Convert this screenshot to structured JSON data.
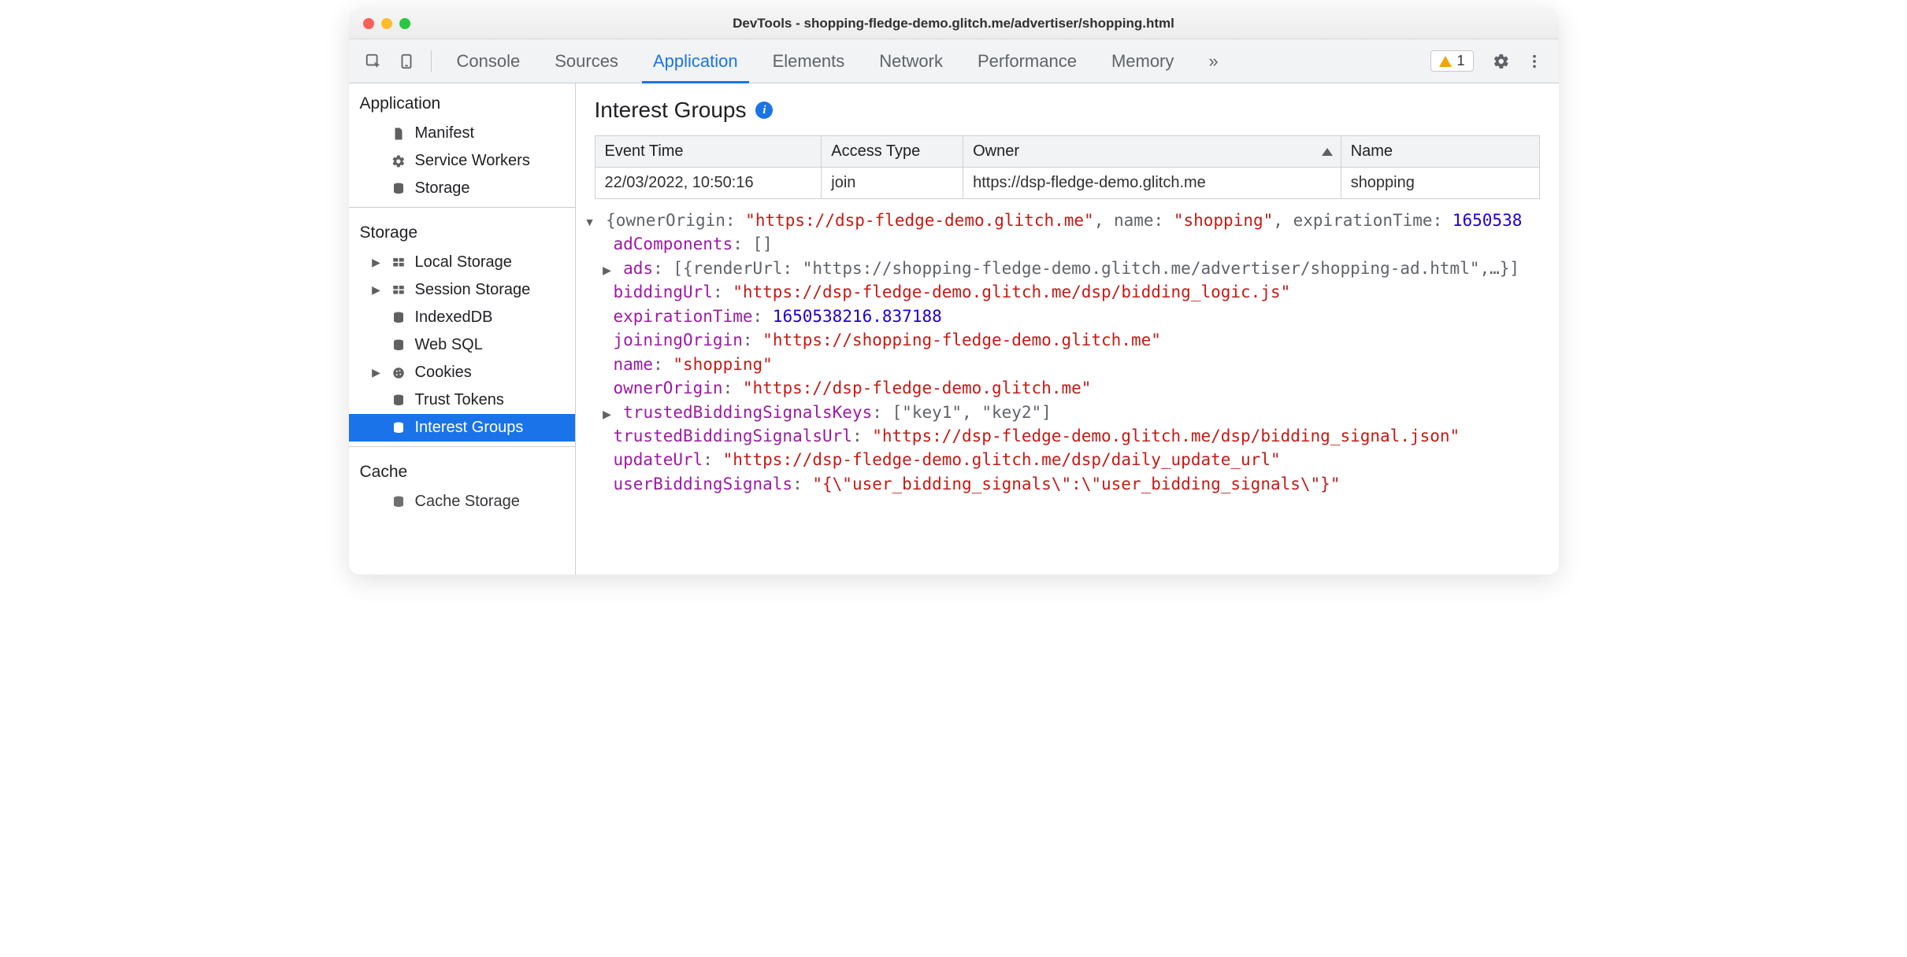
{
  "window": {
    "title": "DevTools - shopping-fledge-demo.glitch.me/advertiser/shopping.html",
    "warning_count": "1"
  },
  "tabs": {
    "items": [
      "Console",
      "Sources",
      "Application",
      "Elements",
      "Network",
      "Performance",
      "Memory"
    ],
    "active_index": 2,
    "more": "»"
  },
  "sidebar": {
    "section_application": "Application",
    "app_items": [
      "Manifest",
      "Service Workers",
      "Storage"
    ],
    "section_storage": "Storage",
    "storage_items": [
      "Local Storage",
      "Session Storage",
      "IndexedDB",
      "Web SQL",
      "Cookies",
      "Trust Tokens",
      "Interest Groups"
    ],
    "storage_selected_index": 6,
    "section_cache": "Cache",
    "cache_items": [
      "Cache Storage"
    ]
  },
  "pane": {
    "heading": "Interest Groups",
    "columns": [
      "Event Time",
      "Access Type",
      "Owner",
      "Name"
    ],
    "row": {
      "event_time": "22/03/2022, 10:50:16",
      "access_type": "join",
      "owner": "https://dsp-fledge-demo.glitch.me",
      "name": "shopping"
    }
  },
  "inspector": {
    "summary_prefix": "{ownerOrigin: ",
    "summary_owner": "\"https://dsp-fledge-demo.glitch.me\"",
    "summary_mid1": ", name: ",
    "summary_name": "\"shopping\"",
    "summary_mid2": ", expirationTime: ",
    "summary_exp": "1650538",
    "adComponents_key": "adComponents",
    "adComponents_val": "[]",
    "ads_key": "ads",
    "ads_preview": "[{renderUrl: \"https://shopping-fledge-demo.glitch.me/advertiser/shopping-ad.html\",…}]",
    "biddingUrl_key": "biddingUrl",
    "biddingUrl_val": "\"https://dsp-fledge-demo.glitch.me/dsp/bidding_logic.js\"",
    "expirationTime_key": "expirationTime",
    "expirationTime_val": "1650538216.837188",
    "joiningOrigin_key": "joiningOrigin",
    "joiningOrigin_val": "\"https://shopping-fledge-demo.glitch.me\"",
    "name_key": "name",
    "name_val": "\"shopping\"",
    "ownerOrigin_key": "ownerOrigin",
    "ownerOrigin_val": "\"https://dsp-fledge-demo.glitch.me\"",
    "tbsk_key": "trustedBiddingSignalsKeys",
    "tbsk_val": "[\"key1\", \"key2\"]",
    "tbsu_key": "trustedBiddingSignalsUrl",
    "tbsu_val": "\"https://dsp-fledge-demo.glitch.me/dsp/bidding_signal.json\"",
    "updateUrl_key": "updateUrl",
    "updateUrl_val": "\"https://dsp-fledge-demo.glitch.me/dsp/daily_update_url\"",
    "userBiddingSignals_key": "userBiddingSignals",
    "userBiddingSignals_val": "\"{\\\"user_bidding_signals\\\":\\\"user_bidding_signals\\\"}\""
  }
}
